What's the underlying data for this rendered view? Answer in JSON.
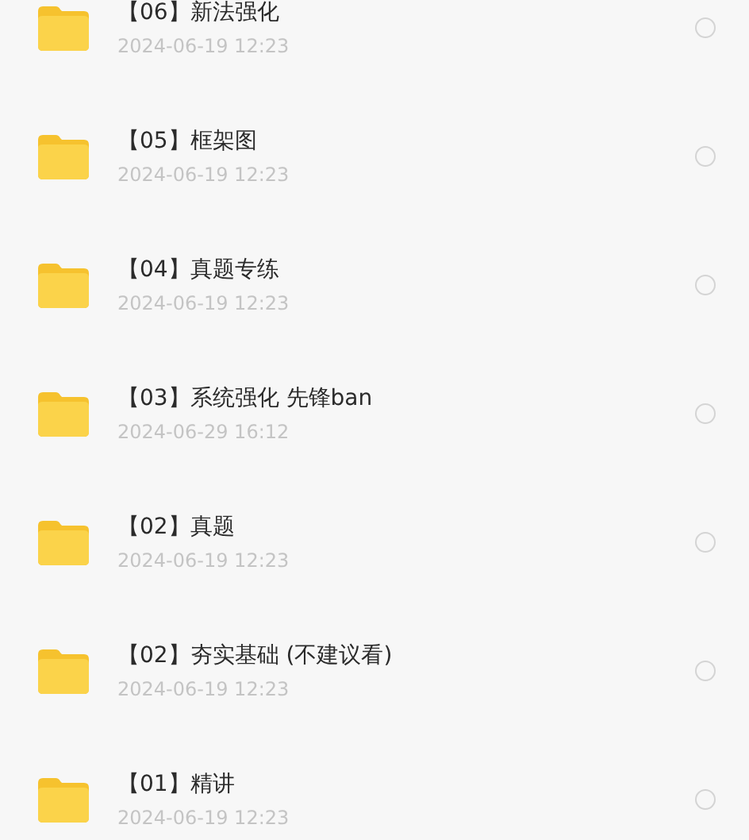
{
  "files": [
    {
      "name": "【06】新法强化",
      "date": "2024-06-19 12:23",
      "selected": false
    },
    {
      "name": "【05】框架图",
      "date": "2024-06-19 12:23",
      "selected": false
    },
    {
      "name": "【04】真题专练",
      "date": "2024-06-19 12:23",
      "selected": false
    },
    {
      "name": "【03】系统强化 先锋ban",
      "date": "2024-06-29 16:12",
      "selected": false
    },
    {
      "name": "【02】真题",
      "date": "2024-06-19 12:23",
      "selected": false
    },
    {
      "name": "【02】夯实基础 (不建议看)",
      "date": "2024-06-19 12:23",
      "selected": false
    },
    {
      "name": "【01】精讲",
      "date": "2024-06-19 12:23",
      "selected": false
    }
  ]
}
